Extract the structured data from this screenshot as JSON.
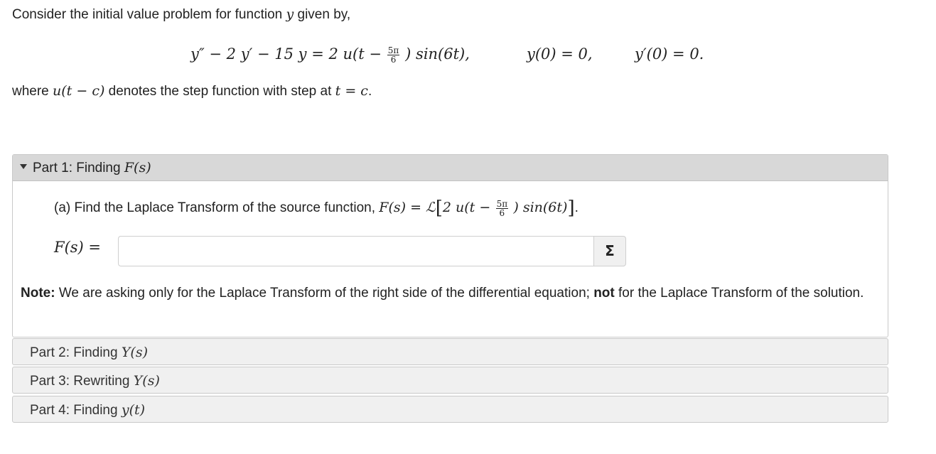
{
  "intro": {
    "text": "Consider the initial value problem for function",
    "var": "y",
    "suffix": "given by,"
  },
  "equation": {
    "lhs": "y″ − 2 y′ − 15 y = 2 u(t −",
    "frac_num": "5π",
    "frac_den": "6",
    "rhs": ") sin(6t),",
    "ic1": "y(0) = 0,",
    "ic2": "y′(0) = 0."
  },
  "where": {
    "prefix": "where",
    "func": "u(t − c)",
    "middle": "denotes the step function with step at",
    "cond": "t = c",
    "end": "."
  },
  "part1": {
    "title": "Part 1: Finding",
    "title_math": "F(s)",
    "question_prefix": "(a) Find the Laplace Transform of the source function,",
    "question_math_a": "F(s) = ℒ",
    "question_math_b": "2 u(t −",
    "frac_num": "5π",
    "frac_den": "6",
    "question_math_c": ") sin(6t)",
    "question_end": ".",
    "answer_label": "F(s) =",
    "answer_value": "",
    "sigma_button": "Σ",
    "note_bold": "Note:",
    "note_text_1": "We are asking only for the Laplace Transform of the right side of the differential equation;",
    "note_bold_2": "not",
    "note_text_2": "for the Laplace Transform of the solution."
  },
  "part2": {
    "title": "Part 2: Finding",
    "title_math": "Y(s)"
  },
  "part3": {
    "title": "Part 3: Rewriting",
    "title_math": "Y(s)"
  },
  "part4": {
    "title": "Part 4: Finding",
    "title_math": "y(t)"
  }
}
